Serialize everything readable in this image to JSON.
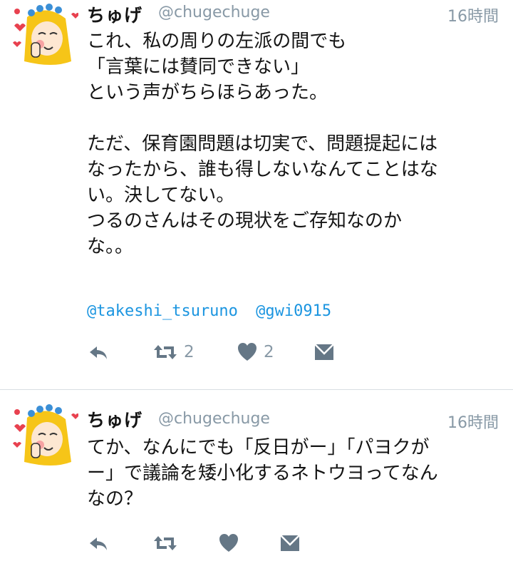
{
  "tweets": [
    {
      "name": "ちゅげ",
      "handle": "@chugechuge",
      "time": "16時間",
      "text": "これ、私の周りの左派の間でも\n「言葉には賛同できない」\nという声がちらほらあった。\n\nただ、保育園問題は切実で、問題提起には\nなったから、誰も得しないなんてことはな\nい。決してない。\nつるのさんはその現状をご存知なのか\nな。。",
      "mentions": [
        "@takeshi_tsuruno",
        "@gwi0915"
      ],
      "retweet_count": "2",
      "like_count": "2"
    },
    {
      "name": "ちゅげ",
      "handle": "@chugechuge",
      "time": "16時間",
      "text": "てか、なんにでも「反日がー」「パヨクが\nー」で議論を矮小化するネトウヨってなん\nなの？",
      "retweet_count": "",
      "like_count": ""
    }
  ],
  "icons": {
    "reply": "reply-icon",
    "retweet": "retweet-icon",
    "like": "heart-icon",
    "dm": "direct-message-icon"
  },
  "colors": {
    "secondary_text": "#8899a6",
    "link": "#1b95e0",
    "icon": "#657786",
    "divider": "#d8dee3"
  }
}
